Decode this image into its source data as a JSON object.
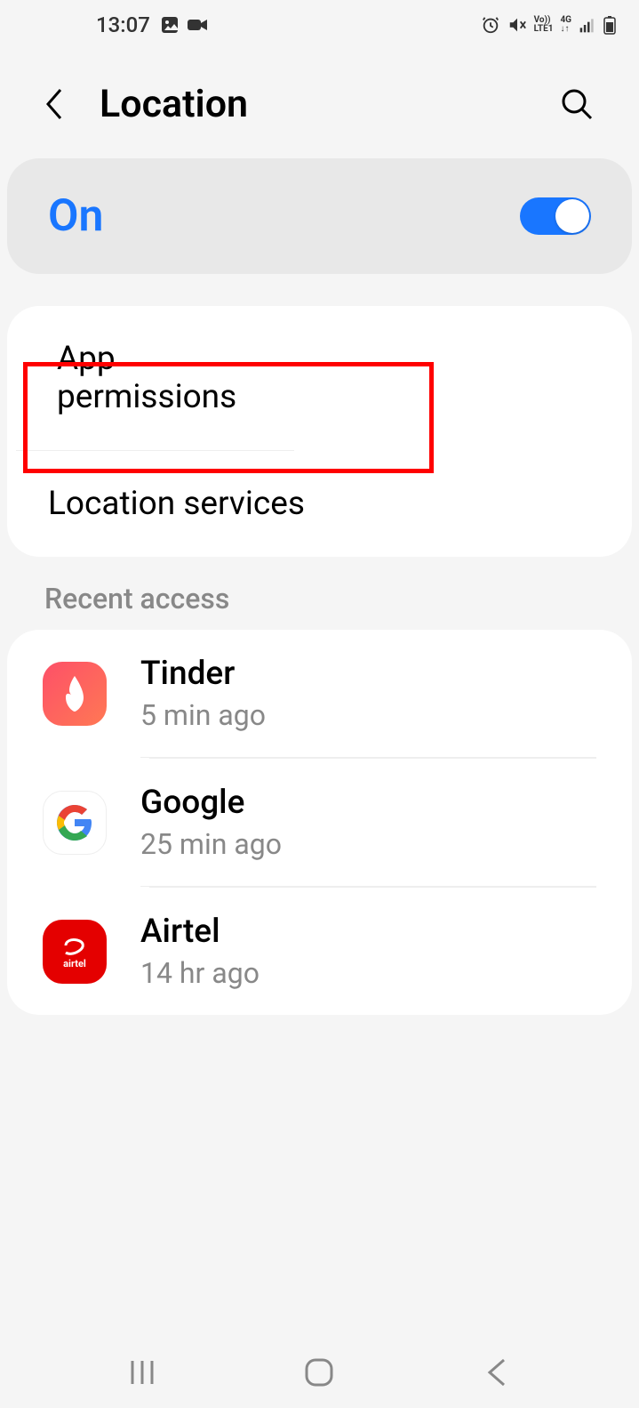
{
  "status_bar": {
    "time": "13:07"
  },
  "header": {
    "title": "Location"
  },
  "location_toggle": {
    "state": "On",
    "enabled": true
  },
  "settings_items": [
    {
      "label": "App permissions"
    },
    {
      "label": "Location services"
    }
  ],
  "recent_access": {
    "header": "Recent access",
    "apps": [
      {
        "name": "Tinder",
        "time": "5 min ago",
        "icon": "tinder"
      },
      {
        "name": "Google",
        "time": "25 min ago",
        "icon": "google"
      },
      {
        "name": "Airtel",
        "time": "14 hr ago",
        "icon": "airtel"
      }
    ]
  }
}
